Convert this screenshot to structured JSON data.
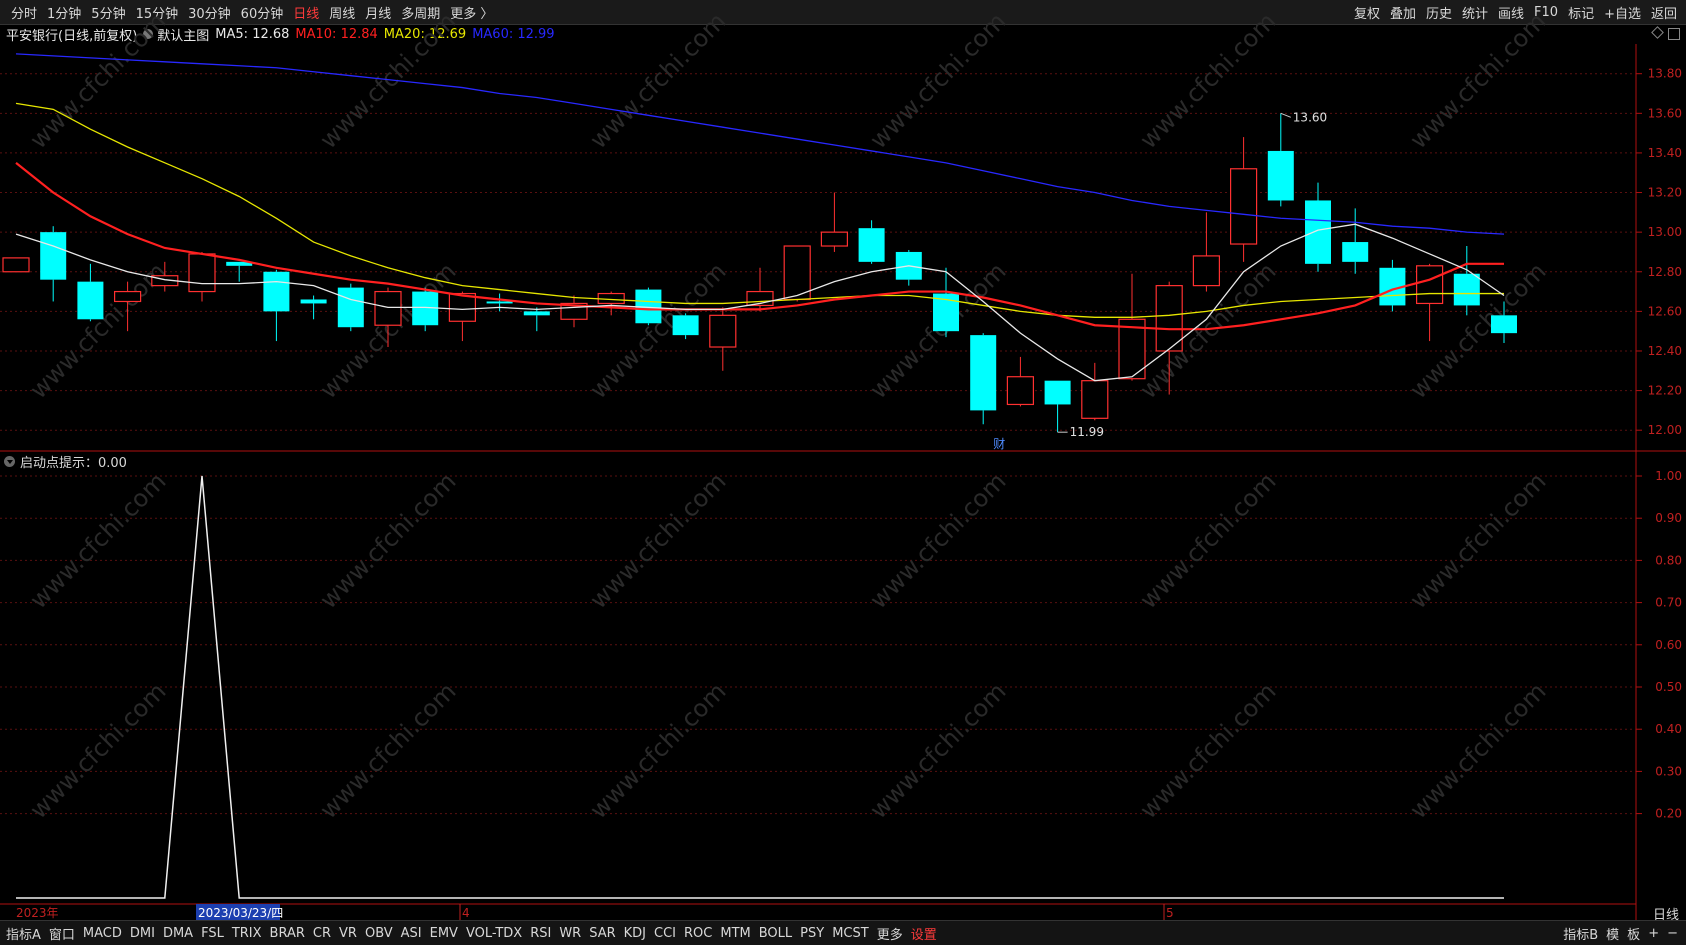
{
  "toolbar": {
    "periods": [
      "分时",
      "1分钟",
      "5分钟",
      "15分钟",
      "30分钟",
      "60分钟",
      "日线",
      "周线",
      "月线",
      "多周期",
      "更多 〉"
    ],
    "active_period": "日线",
    "right_items": [
      "复权",
      "叠加",
      "历史",
      "统计",
      "画线",
      "F10",
      "标记",
      "+自选",
      "返回"
    ]
  },
  "info": {
    "title": "平安银行(日线,前复权)",
    "main_chart": "默认主图",
    "ma5": "MA5: 12.68",
    "ma10": "MA10: 12.84",
    "ma20": "MA20: 12.69",
    "ma60": "MA60: 12.99",
    "colors": {
      "ma5": "#e8e8e8",
      "ma10": "#ff2020",
      "ma20": "#e6e600",
      "ma60": "#2828ff"
    }
  },
  "indicator": {
    "label": "启动点提示：0.00"
  },
  "price_axis": [
    "13.80",
    "13.60",
    "13.40",
    "13.20",
    "13.00",
    "12.80",
    "12.60",
    "12.40",
    "12.20",
    "12.00"
  ],
  "ind_axis": [
    "1.00",
    "0.90",
    "0.80",
    "0.70",
    "0.60",
    "0.50",
    "0.40",
    "0.30",
    "0.20"
  ],
  "annotations": {
    "high": "13.60",
    "low": "11.99",
    "fin_mark": "财"
  },
  "date_axis": {
    "year": "2023年",
    "cursor_date": "2023/03/23/四",
    "apr": "4",
    "may": "5"
  },
  "period_label": "日线",
  "bottom_tabs": [
    "指标A",
    "窗口",
    "MACD",
    "DMI",
    "DMA",
    "FSL",
    "TRIX",
    "BRAR",
    "CR",
    "VR",
    "OBV",
    "ASI",
    "EMV",
    "VOL-TDX",
    "RSI",
    "WR",
    "SAR",
    "KDJ",
    "CCI",
    "ROC",
    "MTM",
    "BOLL",
    "PSY",
    "MCST",
    "更多",
    "设置"
  ],
  "bottom_right": [
    "指标B",
    "模",
    "板",
    "+",
    "−"
  ],
  "watermark": "www.cfchi.com",
  "chart_data": {
    "type": "candlestick",
    "price_range": [
      11.9,
      13.95
    ],
    "candles": [
      {
        "o": 12.8,
        "c": 12.87,
        "h": 12.87,
        "l": 12.8
      },
      {
        "o": 13.0,
        "c": 12.76,
        "h": 13.03,
        "l": 12.65
      },
      {
        "o": 12.75,
        "c": 12.56,
        "h": 12.84,
        "l": 12.55
      },
      {
        "o": 12.65,
        "c": 12.7,
        "h": 12.75,
        "l": 12.5
      },
      {
        "o": 12.73,
        "c": 12.78,
        "h": 12.85,
        "l": 12.7
      },
      {
        "o": 12.7,
        "c": 12.89,
        "h": 12.9,
        "l": 12.65
      },
      {
        "o": 12.85,
        "c": 12.83,
        "h": 12.85,
        "l": 12.75
      },
      {
        "o": 12.8,
        "c": 12.6,
        "h": 12.81,
        "l": 12.45
      },
      {
        "o": 12.66,
        "c": 12.64,
        "h": 12.68,
        "l": 12.56
      },
      {
        "o": 12.72,
        "c": 12.52,
        "h": 12.74,
        "l": 12.5
      },
      {
        "o": 12.53,
        "c": 12.7,
        "h": 12.72,
        "l": 12.42
      },
      {
        "o": 12.7,
        "c": 12.53,
        "h": 12.72,
        "l": 12.5
      },
      {
        "o": 12.55,
        "c": 12.69,
        "h": 12.7,
        "l": 12.45
      },
      {
        "o": 12.65,
        "c": 12.64,
        "h": 12.69,
        "l": 12.6
      },
      {
        "o": 12.6,
        "c": 12.58,
        "h": 12.62,
        "l": 12.5
      },
      {
        "o": 12.56,
        "c": 12.64,
        "h": 12.68,
        "l": 12.52
      },
      {
        "o": 12.64,
        "c": 12.69,
        "h": 12.7,
        "l": 12.58
      },
      {
        "o": 12.71,
        "c": 12.54,
        "h": 12.72,
        "l": 12.53
      },
      {
        "o": 12.58,
        "c": 12.48,
        "h": 12.59,
        "l": 12.46
      },
      {
        "o": 12.42,
        "c": 12.58,
        "h": 12.62,
        "l": 12.3
      },
      {
        "o": 12.63,
        "c": 12.7,
        "h": 12.82,
        "l": 12.6
      },
      {
        "o": 12.66,
        "c": 12.93,
        "h": 12.93,
        "l": 12.65
      },
      {
        "o": 12.93,
        "c": 13.0,
        "h": 13.2,
        "l": 12.9
      },
      {
        "o": 13.02,
        "c": 12.85,
        "h": 13.06,
        "l": 12.84
      },
      {
        "o": 12.9,
        "c": 12.76,
        "h": 12.91,
        "l": 12.73
      },
      {
        "o": 12.69,
        "c": 12.5,
        "h": 12.82,
        "l": 12.47
      },
      {
        "o": 12.48,
        "c": 12.1,
        "h": 12.49,
        "l": 12.03
      },
      {
        "o": 12.13,
        "c": 12.27,
        "h": 12.37,
        "l": 12.12
      },
      {
        "o": 12.25,
        "c": 12.13,
        "h": 12.25,
        "l": 11.99
      },
      {
        "o": 12.06,
        "c": 12.25,
        "h": 12.34,
        "l": 12.05
      },
      {
        "o": 12.26,
        "c": 12.56,
        "h": 12.79,
        "l": 12.25
      },
      {
        "o": 12.4,
        "c": 12.73,
        "h": 12.75,
        "l": 12.18
      },
      {
        "o": 12.73,
        "c": 12.88,
        "h": 13.1,
        "l": 12.7
      },
      {
        "o": 12.94,
        "c": 13.32,
        "h": 13.48,
        "l": 12.85
      },
      {
        "o": 13.41,
        "c": 13.16,
        "h": 13.6,
        "l": 13.13
      },
      {
        "o": 13.16,
        "c": 12.84,
        "h": 13.25,
        "l": 12.8
      },
      {
        "o": 12.95,
        "c": 12.85,
        "h": 13.12,
        "l": 12.79
      },
      {
        "o": 12.82,
        "c": 12.63,
        "h": 12.86,
        "l": 12.6
      },
      {
        "o": 12.64,
        "c": 12.83,
        "h": 12.84,
        "l": 12.45
      },
      {
        "o": 12.79,
        "c": 12.63,
        "h": 12.93,
        "l": 12.58
      },
      {
        "o": 12.58,
        "c": 12.49,
        "h": 12.65,
        "l": 12.44
      }
    ],
    "ma5": [
      12.99,
      12.93,
      12.86,
      12.8,
      12.76,
      12.74,
      12.74,
      12.75,
      12.73,
      12.66,
      12.62,
      12.62,
      12.61,
      12.62,
      12.61,
      12.62,
      12.63,
      12.62,
      12.61,
      12.61,
      12.64,
      12.68,
      12.75,
      12.8,
      12.83,
      12.8,
      12.65,
      12.49,
      12.36,
      12.25,
      12.27,
      12.41,
      12.56,
      12.8,
      12.93,
      13.01,
      13.04,
      12.97,
      12.89,
      12.81,
      12.68
    ],
    "ma10": [
      13.35,
      13.2,
      13.08,
      12.99,
      12.92,
      12.89,
      12.86,
      12.82,
      12.79,
      12.76,
      12.74,
      12.71,
      12.68,
      12.66,
      12.64,
      12.63,
      12.62,
      12.61,
      12.61,
      12.61,
      12.61,
      12.63,
      12.66,
      12.68,
      12.7,
      12.7,
      12.67,
      12.63,
      12.58,
      12.53,
      12.52,
      12.51,
      12.51,
      12.53,
      12.56,
      12.59,
      12.63,
      12.71,
      12.76,
      12.84,
      12.84
    ],
    "ma20": [
      13.65,
      13.62,
      13.52,
      13.43,
      13.35,
      13.27,
      13.18,
      13.07,
      12.95,
      12.88,
      12.82,
      12.77,
      12.73,
      12.71,
      12.69,
      12.67,
      12.66,
      12.65,
      12.64,
      12.64,
      12.65,
      12.66,
      12.67,
      12.68,
      12.68,
      12.66,
      12.63,
      12.6,
      12.58,
      12.57,
      12.57,
      12.58,
      12.6,
      12.63,
      12.65,
      12.66,
      12.67,
      12.68,
      12.69,
      12.69,
      12.69
    ],
    "ma60": [
      13.9,
      13.89,
      13.88,
      13.87,
      13.86,
      13.85,
      13.84,
      13.83,
      13.81,
      13.79,
      13.77,
      13.75,
      13.73,
      13.7,
      13.68,
      13.65,
      13.62,
      13.59,
      13.56,
      13.53,
      13.5,
      13.47,
      13.44,
      13.41,
      13.38,
      13.35,
      13.31,
      13.27,
      13.23,
      13.2,
      13.16,
      13.13,
      13.11,
      13.09,
      13.07,
      13.06,
      13.05,
      13.03,
      13.02,
      13.0,
      12.99
    ],
    "indicator_values": [
      0,
      0,
      0,
      0,
      0,
      1,
      0,
      0,
      0,
      0,
      0,
      0,
      0,
      0,
      0,
      0,
      0,
      0,
      0,
      0,
      0,
      0,
      0,
      0,
      0,
      0,
      0,
      0,
      0,
      0,
      0,
      0,
      0,
      0,
      0,
      0,
      0,
      0,
      0,
      0,
      0
    ],
    "indicator_range": [
      0,
      1.0
    ]
  }
}
